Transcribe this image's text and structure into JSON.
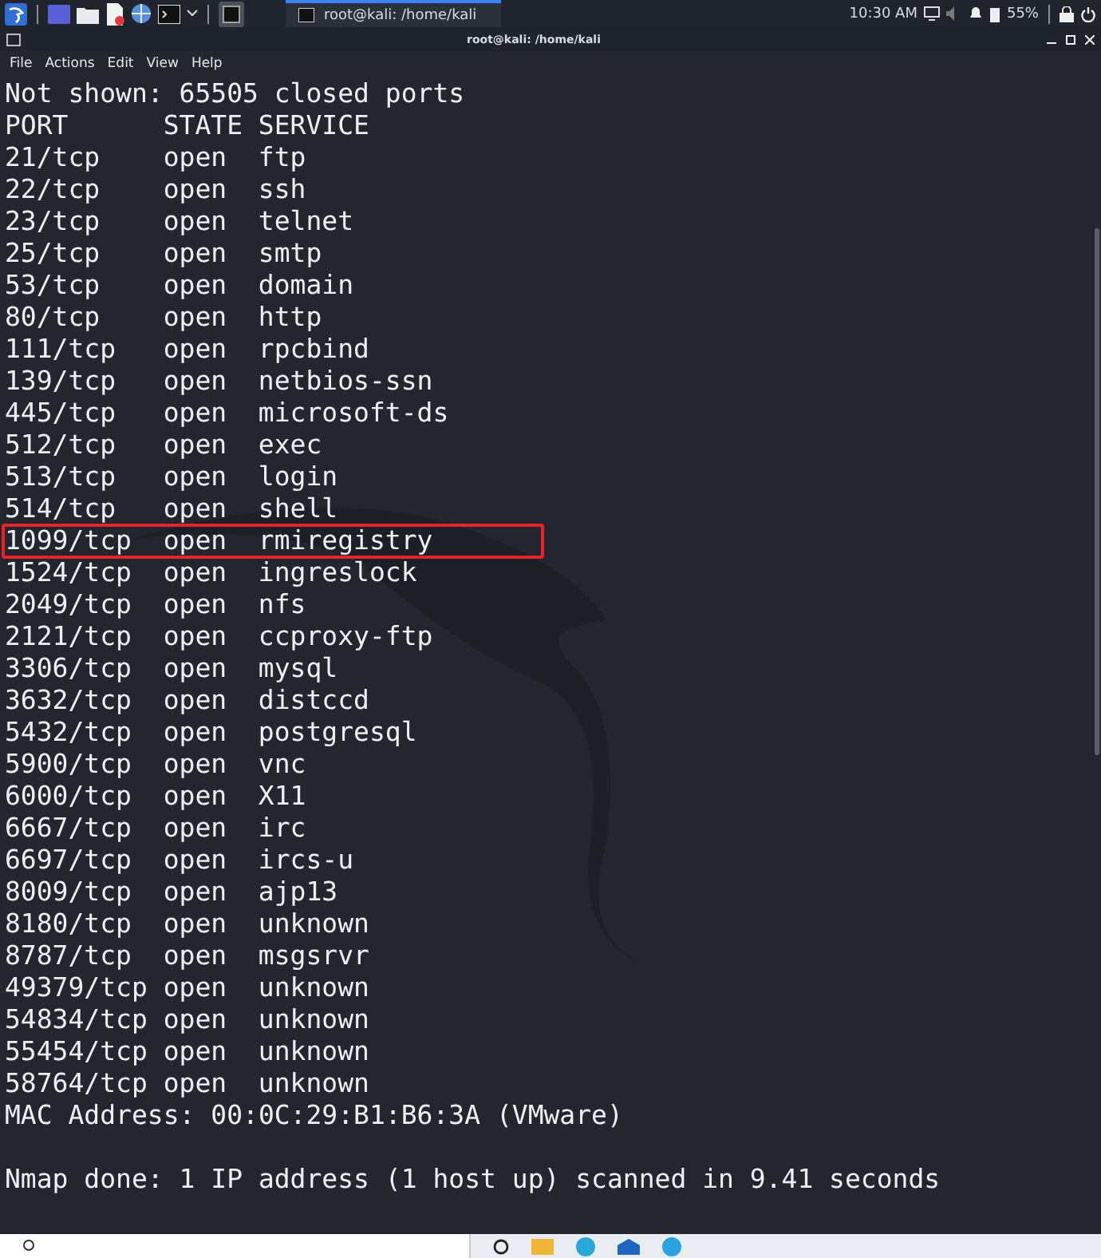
{
  "panel": {
    "task_title": "root@kali: /home/kali",
    "clock": "10:30 AM",
    "battery": "55%"
  },
  "window": {
    "title": "root@kali: /home/kali",
    "menu": [
      "File",
      "Actions",
      "Edit",
      "View",
      "Help"
    ]
  },
  "terminal": {
    "summary": "Not shown: 65505 closed ports",
    "columns": [
      "PORT",
      "STATE",
      "SERVICE"
    ],
    "rows": [
      {
        "port": "21/tcp",
        "state": "open",
        "service": "ftp",
        "highlighted": false
      },
      {
        "port": "22/tcp",
        "state": "open",
        "service": "ssh",
        "highlighted": false
      },
      {
        "port": "23/tcp",
        "state": "open",
        "service": "telnet",
        "highlighted": false
      },
      {
        "port": "25/tcp",
        "state": "open",
        "service": "smtp",
        "highlighted": false
      },
      {
        "port": "53/tcp",
        "state": "open",
        "service": "domain",
        "highlighted": false
      },
      {
        "port": "80/tcp",
        "state": "open",
        "service": "http",
        "highlighted": false
      },
      {
        "port": "111/tcp",
        "state": "open",
        "service": "rpcbind",
        "highlighted": false
      },
      {
        "port": "139/tcp",
        "state": "open",
        "service": "netbios-ssn",
        "highlighted": false
      },
      {
        "port": "445/tcp",
        "state": "open",
        "service": "microsoft-ds",
        "highlighted": false
      },
      {
        "port": "512/tcp",
        "state": "open",
        "service": "exec",
        "highlighted": false
      },
      {
        "port": "513/tcp",
        "state": "open",
        "service": "login",
        "highlighted": false
      },
      {
        "port": "514/tcp",
        "state": "open",
        "service": "shell",
        "highlighted": false
      },
      {
        "port": "1099/tcp",
        "state": "open",
        "service": "rmiregistry",
        "highlighted": true
      },
      {
        "port": "1524/tcp",
        "state": "open",
        "service": "ingreslock",
        "highlighted": false
      },
      {
        "port": "2049/tcp",
        "state": "open",
        "service": "nfs",
        "highlighted": false
      },
      {
        "port": "2121/tcp",
        "state": "open",
        "service": "ccproxy-ftp",
        "highlighted": false
      },
      {
        "port": "3306/tcp",
        "state": "open",
        "service": "mysql",
        "highlighted": false
      },
      {
        "port": "3632/tcp",
        "state": "open",
        "service": "distccd",
        "highlighted": false
      },
      {
        "port": "5432/tcp",
        "state": "open",
        "service": "postgresql",
        "highlighted": false
      },
      {
        "port": "5900/tcp",
        "state": "open",
        "service": "vnc",
        "highlighted": false
      },
      {
        "port": "6000/tcp",
        "state": "open",
        "service": "X11",
        "highlighted": false
      },
      {
        "port": "6667/tcp",
        "state": "open",
        "service": "irc",
        "highlighted": false
      },
      {
        "port": "6697/tcp",
        "state": "open",
        "service": "ircs-u",
        "highlighted": false
      },
      {
        "port": "8009/tcp",
        "state": "open",
        "service": "ajp13",
        "highlighted": false
      },
      {
        "port": "8180/tcp",
        "state": "open",
        "service": "unknown",
        "highlighted": false
      },
      {
        "port": "8787/tcp",
        "state": "open",
        "service": "msgsrvr",
        "highlighted": false
      },
      {
        "port": "49379/tcp",
        "state": "open",
        "service": "unknown",
        "highlighted": false
      },
      {
        "port": "54834/tcp",
        "state": "open",
        "service": "unknown",
        "highlighted": false
      },
      {
        "port": "55454/tcp",
        "state": "open",
        "service": "unknown",
        "highlighted": false
      },
      {
        "port": "58764/tcp",
        "state": "open",
        "service": "unknown",
        "highlighted": false
      }
    ],
    "mac_line": "MAC Address: 00:0C:29:B1:B6:3A (VMware)",
    "done_line": "Nmap done: 1 IP address (1 host up) scanned in 9.41 seconds"
  }
}
